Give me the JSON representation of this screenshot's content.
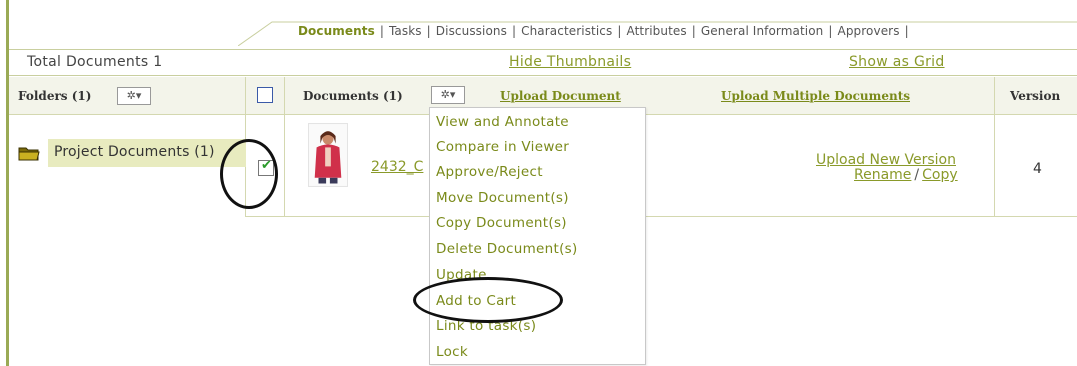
{
  "tabs": [
    "Documents",
    "Tasks",
    "Discussions",
    "Characteristics",
    "Attributes",
    "General Information",
    "Approvers"
  ],
  "summary": {
    "total_documents": "Total Documents  1",
    "hide_thumbnails": "Hide  Thumbnails",
    "show_as_grid": "Show  as Grid"
  },
  "header": {
    "folders": "Folders (1)",
    "documents": "Documents (1)",
    "upload_document": "Upload Document",
    "upload_multiple": "Upload Multiple Documents",
    "version": "Version",
    "gear_glyph": "✲▾"
  },
  "folder": {
    "label": "Project Documents (1)"
  },
  "document": {
    "name": "2432_C",
    "upload_new_version": "Upload New Version",
    "rename": "Rename",
    "slash": "/",
    "copy": "Copy",
    "version": "4",
    "checked": true
  },
  "menu": {
    "items": [
      "View and Annotate",
      "Compare in Viewer",
      "Approve/Reject",
      "Move Document(s)",
      "Copy Document(s)",
      "Delete Document(s)",
      "Update",
      "Add to Cart",
      "Link to task(s)",
      "Lock"
    ]
  },
  "colors": {
    "accent": "#7a8a1a",
    "link": "#8a9a2a",
    "folder_highlight": "#e8ebbf",
    "header_bg": "#f3f4ea"
  }
}
